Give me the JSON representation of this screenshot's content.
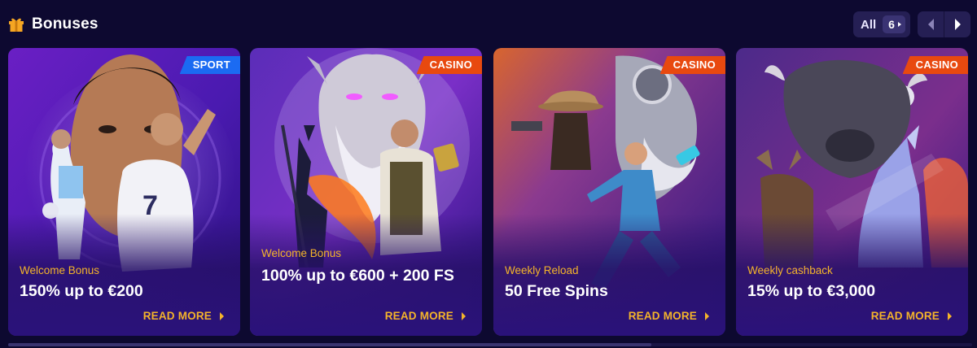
{
  "header": {
    "title": "Bonuses",
    "icon": "gift-icon",
    "all_label": "All",
    "count": "6",
    "prev_icon": "chevron-left-icon",
    "next_icon": "chevron-right-icon"
  },
  "colors": {
    "background": "#0d0930",
    "accent_gold": "#f5b42a",
    "sport_tag": "#1b6bf2",
    "casino_tag": "#e8490f",
    "card_purple": "#3b1a9e"
  },
  "cards": [
    {
      "tag": "SPORT",
      "category": "Welcome Bonus",
      "title": "150% up to €200",
      "read_more": "READ MORE"
    },
    {
      "tag": "CASINO",
      "category": "Welcome Bonus",
      "title": "100% up to €600 + 200 FS",
      "read_more": "READ MORE"
    },
    {
      "tag": "CASINO",
      "category": "Weekly Reload",
      "title": "50 Free Spins",
      "read_more": "READ MORE"
    },
    {
      "tag": "CASINO",
      "category": "Weekly cashback",
      "title": "15% up to €3,000",
      "read_more": "READ MORE"
    }
  ]
}
